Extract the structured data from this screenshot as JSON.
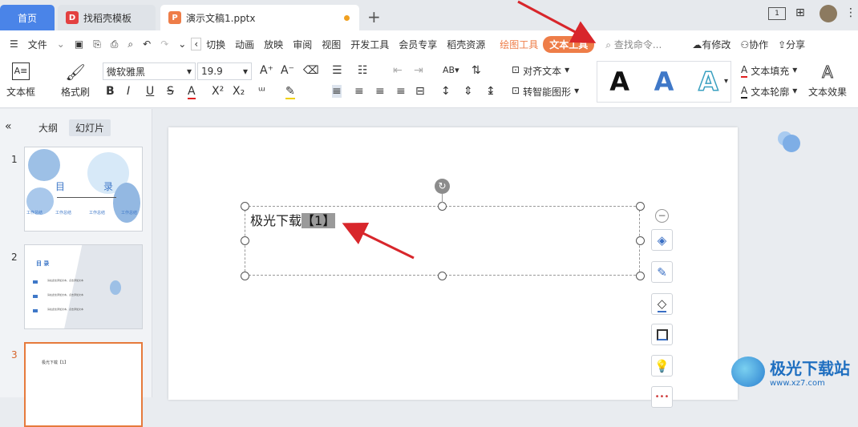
{
  "tabs": {
    "home": "首页",
    "template": "找稻壳模板",
    "doc": "演示文稿1.pptx",
    "new_tab": "+"
  },
  "menu": {
    "file": "文件",
    "items": [
      "切换",
      "动画",
      "放映",
      "审阅",
      "视图",
      "开发工具",
      "会员专享",
      "稻壳资源"
    ],
    "drawing_tools": "绘图工具",
    "text_tools": "文本工具",
    "search": "查找命令...",
    "changes": "有修改",
    "collab": "协作",
    "share": "分享"
  },
  "ribbon": {
    "textbox": "文本框",
    "format_painter": "格式刷",
    "font_name": "微软雅黑",
    "font_size": "19.9",
    "align_text": "对齐文本",
    "smart_art": "转智能图形",
    "text_fill": "文本填充",
    "text_outline": "文本轮廓",
    "text_effect": "文本效果",
    "style_letter": "A"
  },
  "panel": {
    "outline_tab": "大纲",
    "slides_tab": "幻灯片",
    "collapse": "«"
  },
  "slides": [
    {
      "num": "1",
      "title_left": "目",
      "title_right": "录",
      "labels": [
        "工作总结",
        "工作总结",
        "工作总结",
        "工作总结"
      ]
    },
    {
      "num": "2",
      "title": "目 录",
      "lines": [
        "请在此处添加文本，点击添加文本",
        "请在此处添加文本，点击添加文本",
        "请在此处添加文本，点击添加文本"
      ]
    },
    {
      "num": "3",
      "text": "极光下载【1】"
    }
  ],
  "textbox_content": {
    "main": "极光下载",
    "field": "【1】"
  },
  "watermark": {
    "text": "极光下载站",
    "url": "www.xz7.com"
  },
  "colors": {
    "accent": "#4a84e8",
    "orange": "#ee7d48",
    "arrow": "#d8262b"
  }
}
